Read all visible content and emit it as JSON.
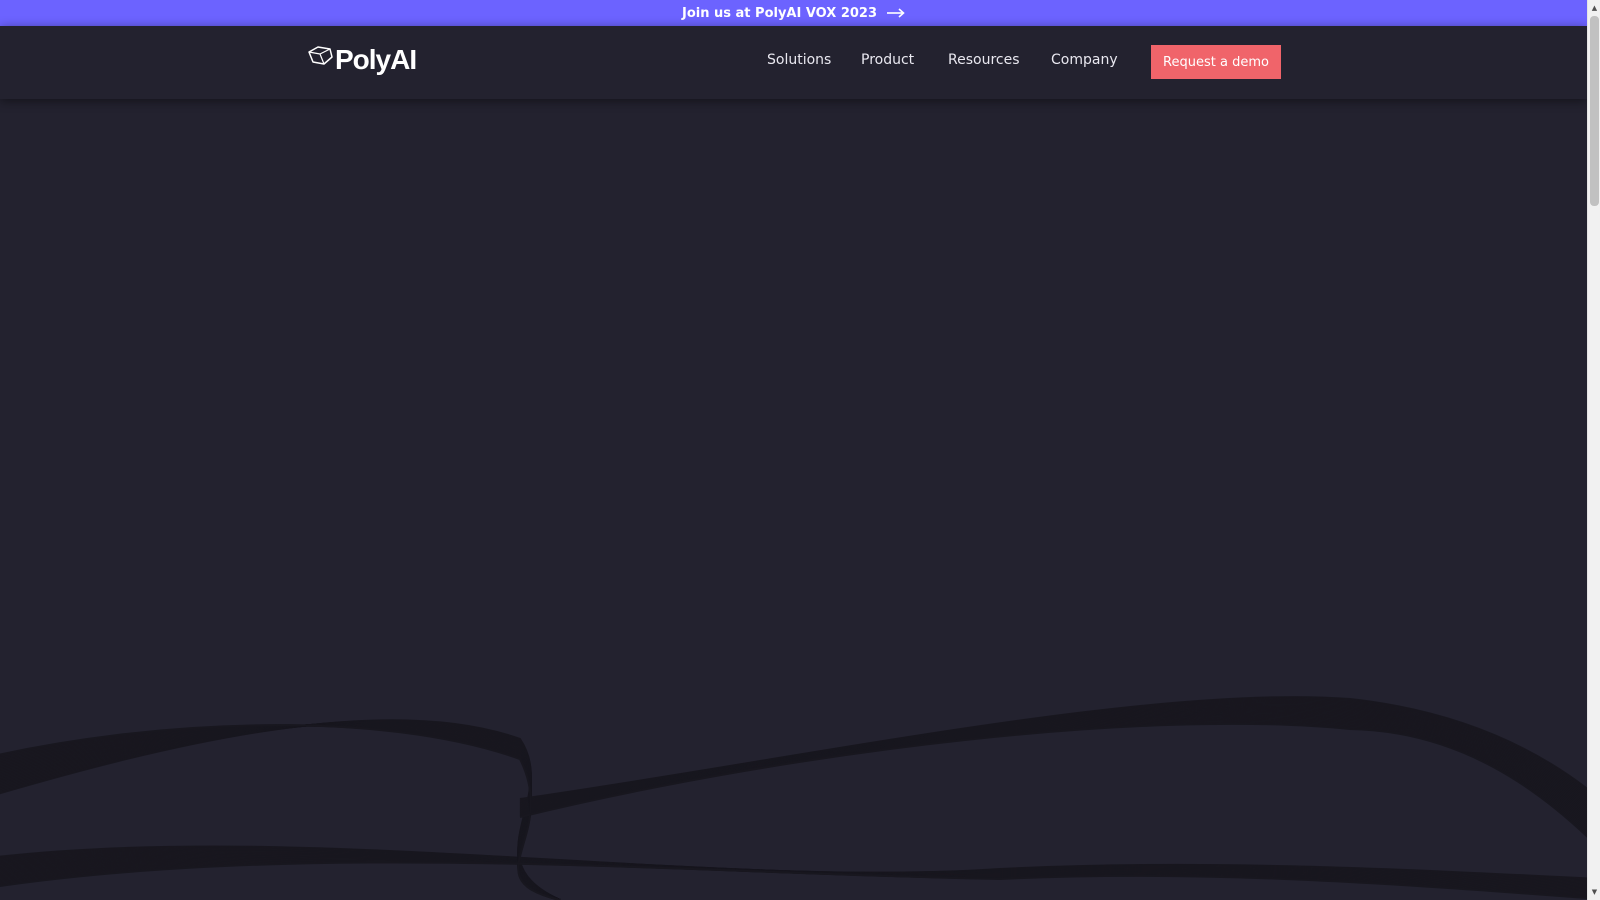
{
  "announcement": {
    "text": "Join us at PolyAI VOX 2023",
    "icon": "arrow-right-icon"
  },
  "header": {
    "logo_text": "PolyAI",
    "nav": [
      {
        "label": "Solutions"
      },
      {
        "label": "Product"
      },
      {
        "label": "Resources"
      },
      {
        "label": "Company"
      }
    ],
    "cta_label": "Request a demo"
  },
  "colors": {
    "announcement_bg": "#6c63ff",
    "page_bg": "#23222f",
    "cta_bg": "#f0646a",
    "wave_stroke": "#16151f"
  }
}
